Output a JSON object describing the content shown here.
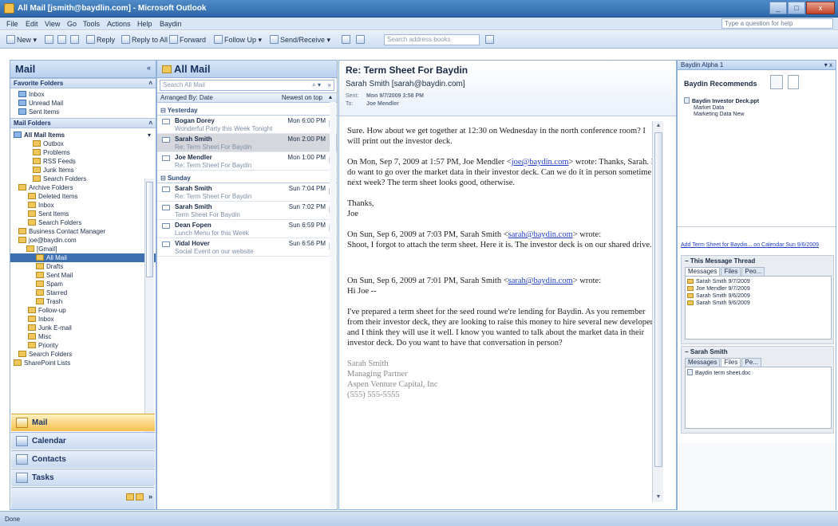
{
  "window": {
    "title": "All Mail [jsmith@baydlin.com] - Microsoft Outlook",
    "controls": [
      "_",
      "□",
      "x"
    ]
  },
  "menu": [
    "File",
    "Edit",
    "View",
    "Go",
    "Tools",
    "Actions",
    "Help",
    "Baydin"
  ],
  "help_search_placeholder": "Type a question for help",
  "toolbar": {
    "new": "New",
    "reply": "Reply",
    "reply_all": "Reply to All",
    "forward": "Forward",
    "follow_up": "Follow Up",
    "send_receive": "Send/Receive",
    "search_placeholder": "Search address books"
  },
  "nav": {
    "title": "Mail",
    "favorites_header": "Favorite Folders",
    "favorites": [
      "Inbox",
      "Unread Mail",
      "Sent Items"
    ],
    "mail_folders_header": "Mail Folders",
    "all_mail_items": "All Mail Items",
    "folders": [
      {
        "label": "Outbox",
        "indent": 28,
        "sel": false
      },
      {
        "label": "Problems",
        "indent": 28,
        "sel": false
      },
      {
        "label": "RSS Feeds",
        "indent": 28,
        "sel": false
      },
      {
        "label": "Junk Items",
        "indent": 28,
        "sel": false
      },
      {
        "label": "Search Folders",
        "indent": 28,
        "sel": false
      },
      {
        "label": "Archive Folders",
        "indent": 10,
        "sel": false
      },
      {
        "label": "Deleted Items",
        "indent": 22,
        "sel": false
      },
      {
        "label": "Inbox",
        "indent": 22,
        "sel": false
      },
      {
        "label": "Sent Items",
        "indent": 22,
        "sel": false
      },
      {
        "label": "Search Folders",
        "indent": 22,
        "sel": false
      },
      {
        "label": "Business Contact Manager",
        "indent": 10,
        "sel": false
      },
      {
        "label": "joe@baydin.com",
        "indent": 10,
        "sel": false
      },
      {
        "label": "[Gmail]",
        "indent": 20,
        "sel": false
      },
      {
        "label": "All Mail",
        "indent": 32,
        "sel": true
      },
      {
        "label": "Drafts",
        "indent": 32,
        "sel": false
      },
      {
        "label": "Sent Mail",
        "indent": 32,
        "sel": false
      },
      {
        "label": "Spam",
        "indent": 32,
        "sel": false
      },
      {
        "label": "Starred",
        "indent": 32,
        "sel": false
      },
      {
        "label": "Trash",
        "indent": 32,
        "sel": false
      },
      {
        "label": "Follow-up",
        "indent": 22,
        "sel": false
      },
      {
        "label": "Inbox",
        "indent": 22,
        "sel": false
      },
      {
        "label": "Junk E-mail",
        "indent": 22,
        "sel": false
      },
      {
        "label": "Misc",
        "indent": 22,
        "sel": false
      },
      {
        "label": "Priority",
        "indent": 22,
        "sel": false
      },
      {
        "label": "Search Folders",
        "indent": 10,
        "sel": false
      },
      {
        "label": "SharePoint Lists",
        "indent": 4,
        "sel": false
      }
    ],
    "buttons": [
      "Mail",
      "Calendar",
      "Contacts",
      "Tasks"
    ]
  },
  "list": {
    "title": "All Mail",
    "search_placeholder": "Search All Mail",
    "arranged_by": "Arranged By: Date",
    "sort": "Newest on top",
    "groups": [
      {
        "label": "Yesterday",
        "messages": [
          {
            "from": "Bogan Dorey",
            "subject": "Wonderful Party this Week Tonight",
            "date": "Mon 6:00 PM",
            "sel": false
          },
          {
            "from": "Sarah Smith",
            "subject": "Re: Term Sheet For Baydin",
            "date": "Mon 2:00 PM",
            "sel": true
          },
          {
            "from": "Joe Mendler",
            "subject": "Re: Term Sheet For Baydin",
            "date": "Mon 1:00 PM",
            "sel": false
          }
        ]
      },
      {
        "label": "Sunday",
        "messages": [
          {
            "from": "Sarah Smith",
            "subject": "Re: Term Sheet For Baydin",
            "date": "Sun 7:04 PM",
            "sel": false
          },
          {
            "from": "Sarah Smith",
            "subject": "Term Sheet For Baydin",
            "date": "Sun 7:02 PM",
            "sel": false
          },
          {
            "from": "Dean Fopen",
            "subject": "Lunch Menu for this Week",
            "date": "Sun 6:59 PM",
            "sel": false
          },
          {
            "from": "Vidal Hover",
            "subject": "Social Event on our website",
            "date": "Sun 6:56 PM",
            "sel": false
          }
        ]
      }
    ]
  },
  "reader": {
    "subject": "Re: Term Sheet For Baydin",
    "sender": "Sarah Smith [sarah@baydin.com]",
    "sent_label": "Sent:",
    "sent": "Mon 9/7/2009 3:58 PM",
    "to_label": "To:",
    "to": "Joe Mendler",
    "body": [
      "Sure.  How about we get together at 12:30 on Wednesday in the north conference room?  I will print out the investor deck.",
      "On Mon, Sep 7, 2009 at 1:57 PM, Joe Mendler <joe@baydin.com> wrote: Thanks, Sarah.  I do want to go over the market data in their investor deck.  Can we do it in person sometime next week?  The term sheet looks good, otherwise.",
      "Thanks,\nJoe",
      "On Sun, Sep 6, 2009 at 7:03 PM, Sarah Smith <sarah@baydin.com> wrote: Shoot, I forgot to attach the term sheet.  Here it is.  The investor deck is on our shared drive.",
      "On Sun, Sep 6, 2009 at 7:01 PM, Sarah Smith <sarah@baydin.com> wrote:\nHi Joe --",
      "I've prepared a term sheet for the seed round we're lending for Baydin.  As you remember from their investor deck, they are looking to raise this money to hire several new developers, and I think they will use it well.  I know you wanted to talk about the market data in their investor deck.  Do you want to have that conversation in person?"
    ],
    "signature": [
      "Sarah Smith",
      "Managing Partner",
      "Aspen Venture Capital, Inc",
      "(555) 555-5555"
    ]
  },
  "todo": {
    "header": "Baydin Alpha 1",
    "title": "Baydin Recommends",
    "recommend_items": [
      "Baydin Investor Deck.ppt",
      "Market Data",
      "Marketing Data New"
    ],
    "calendar_link": "Add Term Sheet for Baydin... on Calendar Sun 9/6/2009",
    "thread_header": "This Message Thread",
    "thread_tabs": [
      "Messages",
      "Files",
      "Peo..."
    ],
    "thread_items": [
      "Sarah Smith 9/7/2009",
      "Joe Mendler 9/7/2009",
      "Sarah Smith 9/6/2009",
      "Sarah Smith 9/6/2009"
    ],
    "person_header": "Sarah Smith",
    "person_tabs": [
      "Messages",
      "Files",
      "Pe..."
    ],
    "person_items": [
      "Baydin term sheet.doc"
    ]
  },
  "status": "Done"
}
